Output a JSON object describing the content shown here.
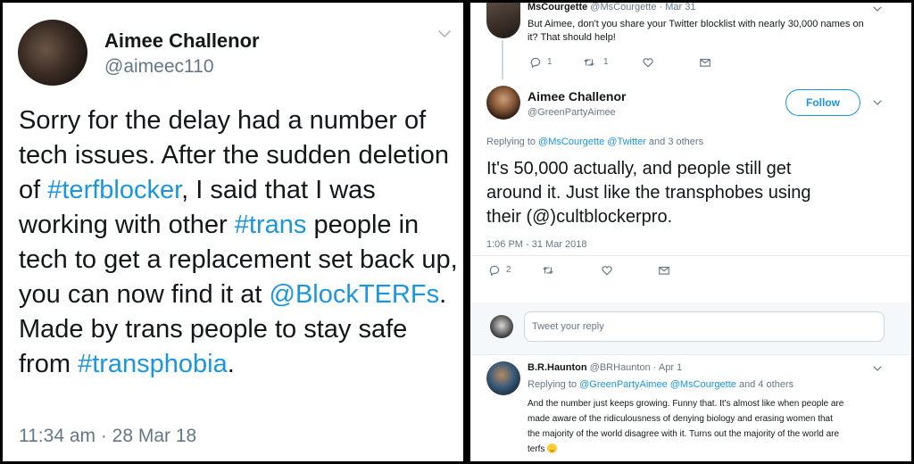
{
  "left_tweet": {
    "author_name": "Aimee Challenor",
    "author_handle": "@aimeec110",
    "body": [
      {
        "text": "Sorry for the delay had a number of tech issues. After the sudden deletion of ",
        "link": false
      },
      {
        "text": "#terfblocker",
        "link": true
      },
      {
        "text": ", I said that I was working with other ",
        "link": false
      },
      {
        "text": "#trans",
        "link": true
      },
      {
        "text": " people in tech to get a replacement set back up, you can now find it at ",
        "link": false
      },
      {
        "text": "@BlockTERFs",
        "link": true
      },
      {
        "text": ". Made by trans people to stay safe from ",
        "link": false
      },
      {
        "text": "#transphobia",
        "link": true
      },
      {
        "text": ".",
        "link": false
      }
    ],
    "timestamp": "11:34 am · 28 Mar 18"
  },
  "right": {
    "parent_tweet": {
      "author_name": "MsCourgette",
      "author_handle": "@MsCourgette",
      "date": "· Mar 31",
      "body_line1": "But Aimee, don't you share your Twitter blocklist with nearly 30,000 names on",
      "body_line2": "it? That should help!",
      "reply_count": "1",
      "retweet_count": "1"
    },
    "main_tweet": {
      "author_name": "Aimee Challenor",
      "author_handle": "@GreenPartyAimee",
      "follow_label": "Follow",
      "replying_prefix": "Replying to ",
      "replying_mentions": "@MsCourgette @Twitter",
      "replying_suffix": " and 3 others",
      "body_line1": "It's 50,000 actually, and people still get",
      "body_line2": "around it. Just like the transphobes using",
      "body_line3": "their (@)cultblockerpro.",
      "timestamp": "1:06 PM - 31 Mar 2018",
      "reply_count": "2"
    },
    "reply_box": {
      "placeholder": "Tweet your reply"
    },
    "reply_tweet": {
      "author_name": "B.R.Haunton",
      "author_handle": "@BRHaunton",
      "date": "· Apr 1",
      "replying_prefix": "Replying to ",
      "replying_mentions": "@GreenPartyAimee @MsCourgette",
      "replying_suffix": " and 4 others",
      "body_line1": "And the number just keeps growing. Funny that. It's almost like when people are",
      "body_line2": "made aware of the ridiculousness of denying biology and erasing women that",
      "body_line3": "the majority of the world disagree with it. Turns out the majority of the world are",
      "body_line4": "terfs"
    }
  },
  "icons": [
    "chevron-down-icon",
    "reply-icon",
    "retweet-icon",
    "like-icon",
    "dm-icon",
    "grin-emoji-icon"
  ]
}
